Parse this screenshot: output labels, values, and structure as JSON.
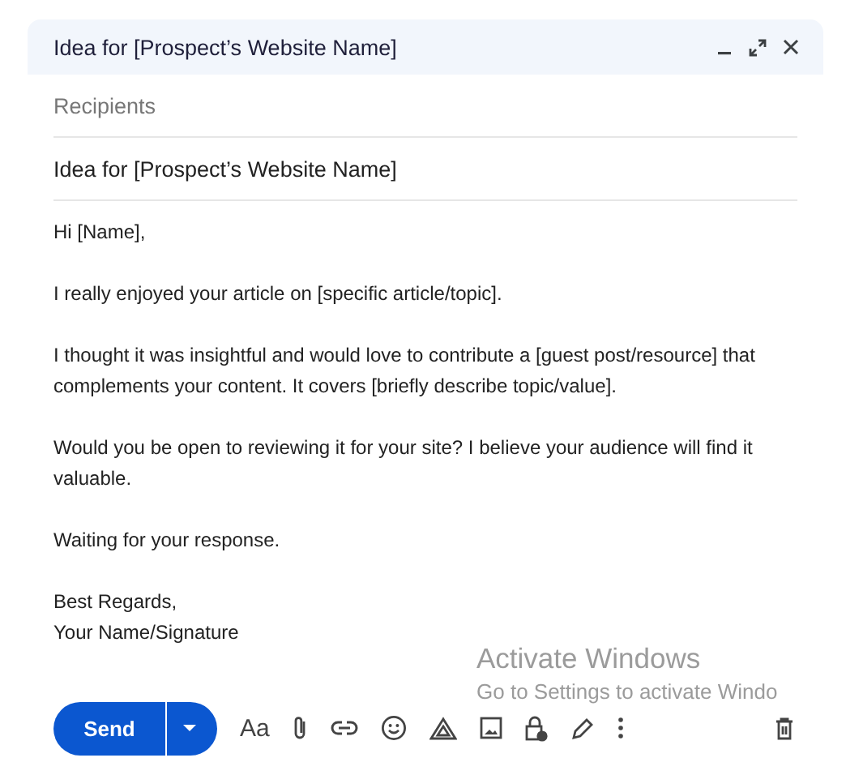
{
  "window": {
    "title": "Idea for [Prospect’s Website Name]"
  },
  "recipients": {
    "placeholder": "Recipients"
  },
  "subject": {
    "value": "Idea for [Prospect’s Website Name]"
  },
  "body": [
    [
      "Hi [Name],"
    ],
    [
      "I really enjoyed your article on [specific article/topic]."
    ],
    [
      "I thought it was insightful and would love to contribute a [guest post/resource] that complements your content. It covers [briefly describe topic/value]."
    ],
    [
      "Would you be open to reviewing it for your site? I believe your audience will find it valuable."
    ],
    [
      "Waiting for your response."
    ],
    [
      "Best Regards,",
      "Your Name/Signature"
    ]
  ],
  "toolbar": {
    "send": "Send",
    "formatting": "Aa"
  },
  "os_notice": {
    "title": "Activate Windows",
    "subtitle": "Go to Settings to activate Windo"
  }
}
